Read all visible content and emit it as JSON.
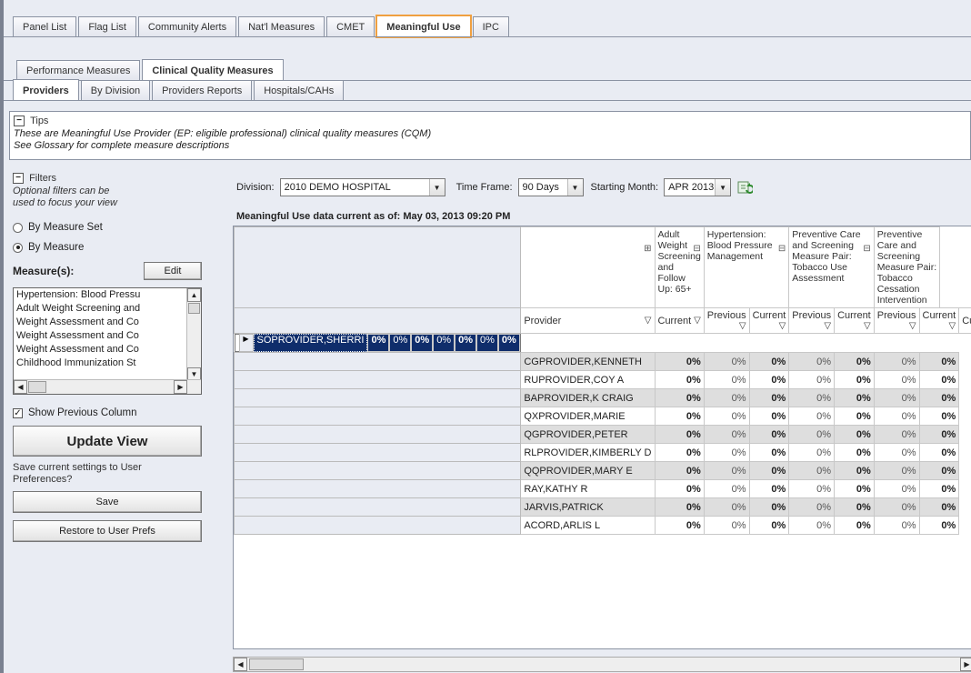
{
  "top_tabs": [
    "Panel List",
    "Flag List",
    "Community Alerts",
    "Nat'l Measures",
    "CMET",
    "Meaningful Use",
    "IPC"
  ],
  "top_tab_active": "Meaningful Use",
  "second_tabs": [
    "Performance Measures",
    "Clinical Quality Measures"
  ],
  "third_tabs": [
    "Providers",
    "By Division",
    "Providers Reports",
    "Hospitals/CAHs"
  ],
  "tips": {
    "label": "Tips",
    "line1": "These are Meaningful Use Provider (EP: eligible professional) clinical quality measures (CQM)",
    "line2": "See Glossary for complete measure descriptions"
  },
  "filters": {
    "label": "Filters",
    "hint1": "Optional filters can be",
    "hint2": "used to focus your view",
    "radio_measure_set": "By Measure Set",
    "radio_measure": "By Measure",
    "measures_label": "Measure(s):",
    "edit_button": "Edit",
    "measure_list": [
      "Hypertension: Blood Pressu",
      "Adult Weight Screening and",
      "Weight Assessment and Co",
      "Weight Assessment and Co",
      "Weight Assessment and Co",
      "Childhood Immunization St"
    ],
    "show_previous": "Show Previous Column",
    "update_view": "Update View",
    "save_prompt1": "Save current settings to User",
    "save_prompt2": "Preferences?",
    "save_button": "Save",
    "restore_button": "Restore to User Prefs"
  },
  "toolbar": {
    "division_label": "Division:",
    "division_value": "2010 DEMO HOSPITAL",
    "timeframe_label": "Time Frame:",
    "timeframe_value": "90 Days",
    "starting_label": "Starting Month:",
    "starting_value": "APR 2013"
  },
  "as_of": "Meaningful Use data current as of:  May 03, 2013 09:20 PM",
  "grid": {
    "group_headers": [
      "Adult Weight Screening and Follow Up: 65+",
      "Hypertension: Blood Pressure Management",
      "Preventive Care and Screening Measure Pair: Tobacco Use Assessment",
      "Preventive Care and Screening Measure Pair: Tobacco Cessation Intervention"
    ],
    "col_headers": {
      "provider": "Provider",
      "current": "Current",
      "previous": "Previous"
    },
    "rows": [
      {
        "name": "SOPROVIDER,SHERRI",
        "vals": [
          "0%",
          "0%",
          "0%",
          "0%",
          "0%",
          "0%",
          "0%"
        ]
      },
      {
        "name": "CGPROVIDER,KENNETH",
        "vals": [
          "0%",
          "0%",
          "0%",
          "0%",
          "0%",
          "0%",
          "0%"
        ]
      },
      {
        "name": "RUPROVIDER,COY A",
        "vals": [
          "0%",
          "0%",
          "0%",
          "0%",
          "0%",
          "0%",
          "0%"
        ]
      },
      {
        "name": "BAPROVIDER,K CRAIG",
        "vals": [
          "0%",
          "0%",
          "0%",
          "0%",
          "0%",
          "0%",
          "0%"
        ]
      },
      {
        "name": "QXPROVIDER,MARIE",
        "vals": [
          "0%",
          "0%",
          "0%",
          "0%",
          "0%",
          "0%",
          "0%"
        ]
      },
      {
        "name": "QGPROVIDER,PETER",
        "vals": [
          "0%",
          "0%",
          "0%",
          "0%",
          "0%",
          "0%",
          "0%"
        ]
      },
      {
        "name": "RLPROVIDER,KIMBERLY D",
        "vals": [
          "0%",
          "0%",
          "0%",
          "0%",
          "0%",
          "0%",
          "0%"
        ]
      },
      {
        "name": "QQPROVIDER,MARY E",
        "vals": [
          "0%",
          "0%",
          "0%",
          "0%",
          "0%",
          "0%",
          "0%"
        ]
      },
      {
        "name": "RAY,KATHY R",
        "vals": [
          "0%",
          "0%",
          "0%",
          "0%",
          "0%",
          "0%",
          "0%"
        ]
      },
      {
        "name": "JARVIS,PATRICK",
        "vals": [
          "0%",
          "0%",
          "0%",
          "0%",
          "0%",
          "0%",
          "0%"
        ]
      },
      {
        "name": "ACORD,ARLIS L",
        "vals": [
          "0%",
          "0%",
          "0%",
          "0%",
          "0%",
          "0%",
          "0%"
        ]
      }
    ]
  }
}
